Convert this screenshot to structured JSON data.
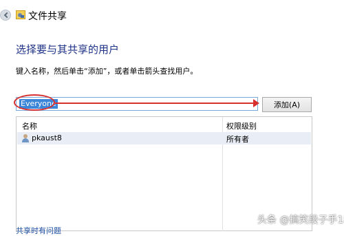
{
  "window": {
    "title": "文件共享",
    "back_icon": "back-arrow-icon",
    "app_icon": "file-sharing-icon"
  },
  "main": {
    "heading": "选择要与其共享的用户",
    "instruction": "键入名称，然后单击“添加”，或者单击箭头查找用户。",
    "name_input": {
      "value": "Everyone",
      "dropdown_icon": "chevron-down-icon"
    },
    "add_button": "添加(A)",
    "annotation_color": "#d8302f"
  },
  "list": {
    "columns": [
      "名称",
      "权限级别"
    ],
    "rows": [
      {
        "name": "pkaust8",
        "permission": "所有者",
        "icon": "user-icon"
      }
    ]
  },
  "footer": {
    "link": "共享时有问题"
  },
  "watermark": "头条 @搞笑段子手18"
}
